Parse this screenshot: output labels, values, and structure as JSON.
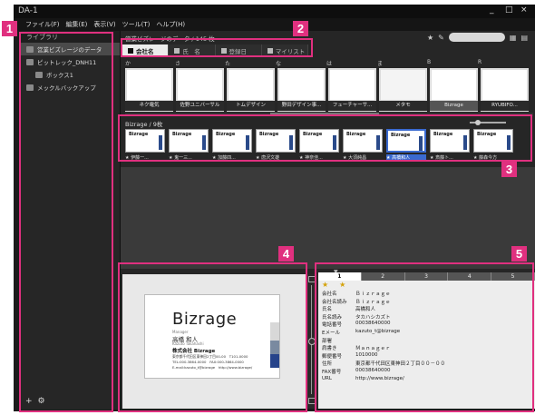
{
  "window": {
    "title": "DA-1",
    "min": "_",
    "max": "□",
    "close": "×"
  },
  "menu": [
    "ファイル(F)",
    "編集(E)",
    "表示(V)",
    "ツール(T)",
    "ヘルプ(H)"
  ],
  "sidebar": {
    "header": "ライブラリ",
    "items": [
      {
        "label": "営業ビズレージのデータ"
      },
      {
        "label": "ピットレック_DNH11"
      },
      {
        "label": "ボックス1"
      },
      {
        "label": "メックルバックアップ"
      }
    ]
  },
  "main": {
    "breadcrumb": "営業ビズレージのデータ / 145 枚",
    "tabs": [
      {
        "label": "会社名"
      },
      {
        "label": "氏　名"
      },
      {
        "label": "登録日"
      },
      {
        "label": "マイリスト"
      }
    ],
    "index_letters": [
      "か",
      "さ",
      "た",
      "な",
      "は",
      "ま",
      "B",
      "R"
    ],
    "cards": [
      "ネク電気",
      "佐野ユニバーサル",
      "トムデザイン",
      "野田デザイン事...",
      "フューチャーサ...",
      "メタモ",
      "Bizrage",
      "RYUBIFO..."
    ],
    "group_title": "Bizrage / 9枚",
    "group_cards": [
      {
        "logo": "Bizrage",
        "label": "★ 伊藤一..."
      },
      {
        "logo": "Bizrage",
        "label": "★ 鬼一三..."
      },
      {
        "logo": "Bizrage",
        "label": "★ 加藤四..."
      },
      {
        "logo": "Bizrage",
        "label": "★ 唐沢文雄"
      },
      {
        "logo": "Bizrage",
        "label": "★ 神奈佳..."
      },
      {
        "logo": "Bizrage",
        "label": "★ 大須純昌"
      },
      {
        "logo": "Bizrage",
        "label": "★ 高橋和人"
      },
      {
        "logo": "Bizrage",
        "label": "★ 斎藤ト..."
      },
      {
        "logo": "Bizrage",
        "label": "★ 藤森今方"
      }
    ]
  },
  "preview_card": {
    "logo": "Bizrage",
    "role": "Manager",
    "name": "高橋 和人",
    "name_roman": "Kazuto Takahashi",
    "company": "株式会社 Bizrage",
    "address": "東京都千代田区東神田2丁目00-00　T101-0000",
    "tel": "TEL:000-3864-0000　FAX:000-3864-0000",
    "email": "E-mail:kazuto_t@bizrage　http://www.bizrage/"
  },
  "details": {
    "tabs": [
      "1",
      "2",
      "3",
      "4",
      "5"
    ],
    "stars": [
      "★",
      "★"
    ],
    "rows": [
      {
        "key": "会社名",
        "value": "Ｂｉｚｒａｇｅ"
      },
      {
        "key": "会社名読み",
        "value": "Ｂｉｚｒａｇｅ"
      },
      {
        "key": "氏名",
        "value": "高橋和人"
      },
      {
        "key": "氏名読み",
        "value": "タカハシカズト"
      },
      {
        "key": "電話番号",
        "value": "00038640000"
      },
      {
        "key": "Eメール",
        "value": "kazuto_t@bizrage"
      },
      {
        "key": "部署",
        "value": ""
      },
      {
        "key": "肩書き",
        "value": "Ｍａｎａｇｅｒ"
      },
      {
        "key": "郵便番号",
        "value": "1010000"
      },
      {
        "key": "住所",
        "value": "東京都千代田区東神田２丁目００－００"
      },
      {
        "key": "FAX番号",
        "value": "00038640000"
      },
      {
        "key": "URL",
        "value": "http://www.bizrage/"
      }
    ]
  },
  "badges": [
    "1",
    "2",
    "3",
    "4",
    "5"
  ],
  "accent_color": "#e0307f"
}
